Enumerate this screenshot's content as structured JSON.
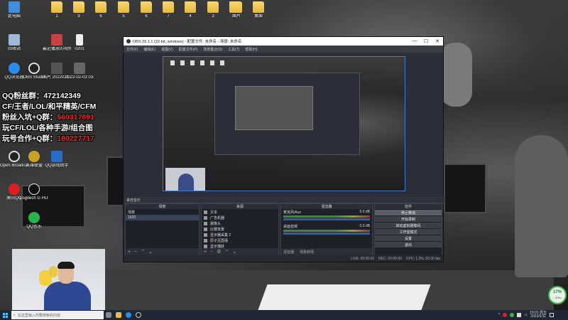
{
  "desktop": {
    "top_icons": [
      {
        "label": "此电脑",
        "type": "app"
      },
      {
        "label": "1",
        "type": "folder"
      },
      {
        "label": "9",
        "type": "folder"
      },
      {
        "label": "6",
        "type": "folder"
      },
      {
        "label": "5",
        "type": "folder"
      },
      {
        "label": "6",
        "type": "folder"
      },
      {
        "label": "7",
        "type": "folder"
      },
      {
        "label": "4",
        "type": "folder"
      },
      {
        "label": "3",
        "type": "folder"
      },
      {
        "label": "2",
        "type": "folder"
      },
      {
        "label": "图片",
        "type": "folder"
      },
      {
        "label": "桌面",
        "type": "folder"
      }
    ],
    "second_row": [
      {
        "label": "回收站",
        "type": "app"
      },
      {
        "label": "最近播放的视频 2.8",
        "type": "file"
      },
      {
        "label": "0201",
        "type": "file"
      }
    ],
    "third_row": [
      {
        "label": "QQ浏览器",
        "type": "app"
      },
      {
        "label": "OBS Studio",
        "type": "app"
      },
      {
        "label": "图片 2022021...",
        "type": "file"
      },
      {
        "label": "2022-02-03 03-27-36",
        "type": "file"
      }
    ],
    "left_column": [
      {
        "label": "Open Broadcast...",
        "type": "app"
      },
      {
        "label": "英雄联盟",
        "type": "app"
      },
      {
        "label": "QQ游戏助手",
        "type": "app"
      },
      {
        "label": "腾讯QQ",
        "type": "app"
      },
      {
        "label": "Logitech G HUB",
        "type": "app"
      },
      {
        "label": "QQ音乐",
        "type": "app"
      }
    ]
  },
  "promo": {
    "line1": "QQ粉丝群：472142349",
    "line2": "CF/王者/LOL/和平精英/CFM",
    "line3_a": "粉丝入坑+Q群：",
    "line3_b": "560317891",
    "line4": "玩CF/LOL/各种手游/组合图",
    "line5_a": "玩号合作+Q群：",
    "line5_b": "180227717"
  },
  "obs": {
    "title": "OBS 26.1.1 (32-bit, windows) - 配置文件: 未命名 - 场景: 未命名",
    "menu": [
      "文件(F)",
      "编辑(E)",
      "视图(V)",
      "配置文件(P)",
      "场景集合(S)",
      "工具(T)",
      "帮助(H)"
    ],
    "minimize": "—",
    "maximize": "☐",
    "close": "✕",
    "scene_bar": "来自音乐",
    "docks": {
      "scenes_title": "场景",
      "sources_title": "来源",
      "mixer_title": "混音器",
      "controls_title": "控件"
    },
    "scenes": [
      "场景",
      "1920"
    ],
    "sources": [
      "文本",
      "广告机器",
      "摄像头",
      "比赛背景",
      "显示器采集 2",
      "原子豆国语",
      "显示捕获"
    ],
    "mixer": [
      {
        "name": "麦克风/Aux",
        "db": "0.0 dB"
      },
      {
        "name": "桌面音频",
        "db": "0.0 dB"
      }
    ],
    "mixer_tabs": [
      "混音器",
      "场景转场"
    ],
    "controls": [
      "停止推流",
      "开始录制",
      "启动虚拟摄像机",
      "工作室模式",
      "设置",
      "退出"
    ],
    "status": {
      "live": "LIVE: 00:00:00",
      "rec": "REC: 00:00:00",
      "cpu": "CPU: 1.3%, 60.00 fps"
    }
  },
  "taskbar": {
    "search_placeholder": "在这里输入你要搜索的内容",
    "clock_time": "19:01 周五",
    "clock_date": "2022/2/11"
  },
  "net_widget": {
    "percent": "17%",
    "speed": "↑ 0KB/s"
  },
  "colors": {
    "obs_bg": "#2b2e38",
    "selection_blue": "#3a7bd5",
    "promo_red": "#ff2020",
    "taskbar": "#1f2634",
    "widget_green": "#3bb54a"
  }
}
